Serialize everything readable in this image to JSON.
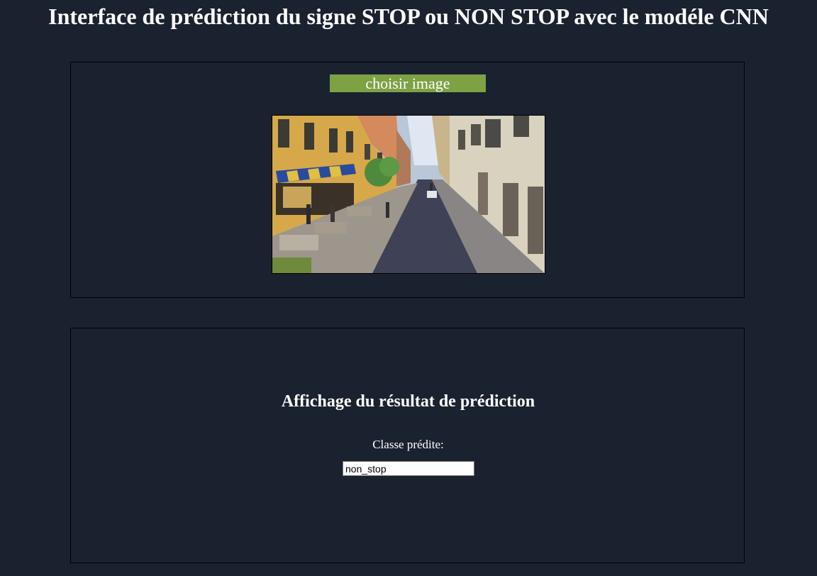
{
  "header": {
    "title": "Interface de prédiction du signe STOP ou NON STOP avec le modéle CNN"
  },
  "upload": {
    "choose_label": "choisir image"
  },
  "result": {
    "heading": "Affichage du résultat de prédiction",
    "class_label": "Classe prédite:",
    "class_value": "non_stop"
  },
  "colors": {
    "background": "#1a2230",
    "button": "#7ea144",
    "text": "#ffffff"
  }
}
